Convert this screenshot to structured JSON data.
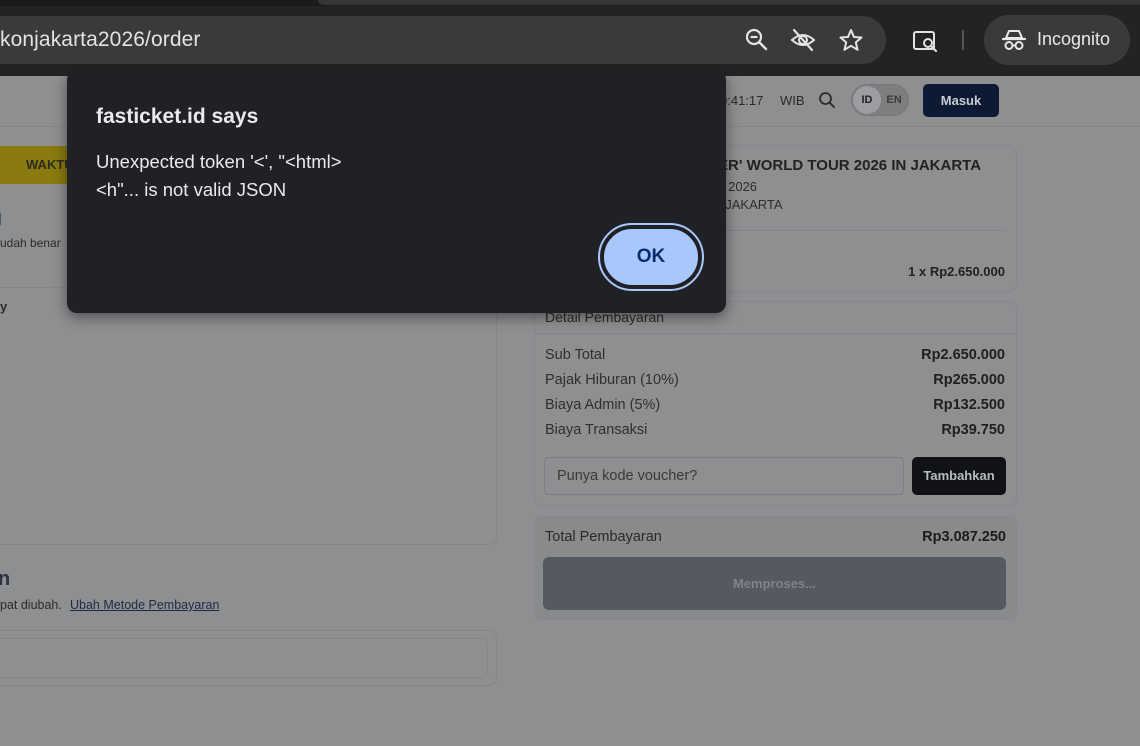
{
  "browser": {
    "url": "konjakarta2026/order",
    "incognito_label": "Incognito"
  },
  "page": {
    "clock": "0:41:17",
    "timezone": "WIB",
    "lang_id": "ID",
    "lang_en": "EN",
    "login_label": "Masuk",
    "timer_label": "WAKTU",
    "left_frag_1": "l",
    "left_frag_2": "udah benar",
    "left_frag_3": "y",
    "left_frag_4": "n",
    "left_frag_5": "pat diubah.",
    "change_payment_link": "Ubah Metode Pembayaran",
    "event": {
      "title": "ER' WORLD TOUR 2026 IN JAKARTA",
      "date": "s 2026",
      "venue": ", JAKARTA",
      "ticket_line": "1 x Rp2.650.000"
    },
    "payment_details": {
      "title": "Detail Pembayaran",
      "rows": [
        {
          "label": "Sub Total",
          "value": "Rp2.650.000"
        },
        {
          "label": "Pajak Hiburan (10%)",
          "value": "Rp265.000"
        },
        {
          "label": "Biaya Admin (5%)",
          "value": "Rp132.500"
        },
        {
          "label": "Biaya Transaksi",
          "value": "Rp39.750"
        }
      ],
      "voucher_placeholder": "Punya kode voucher?",
      "apply_label": "Tambahkan"
    },
    "total": {
      "label": "Total Pembayaran",
      "value": "Rp3.087.250",
      "process_label": "Memproses..."
    }
  },
  "dialog": {
    "title": "fasticket.id says",
    "message_line1": "Unexpected token '<', \"<html>",
    "message_line2": "<h\"... is not valid JSON",
    "ok_label": "OK"
  }
}
